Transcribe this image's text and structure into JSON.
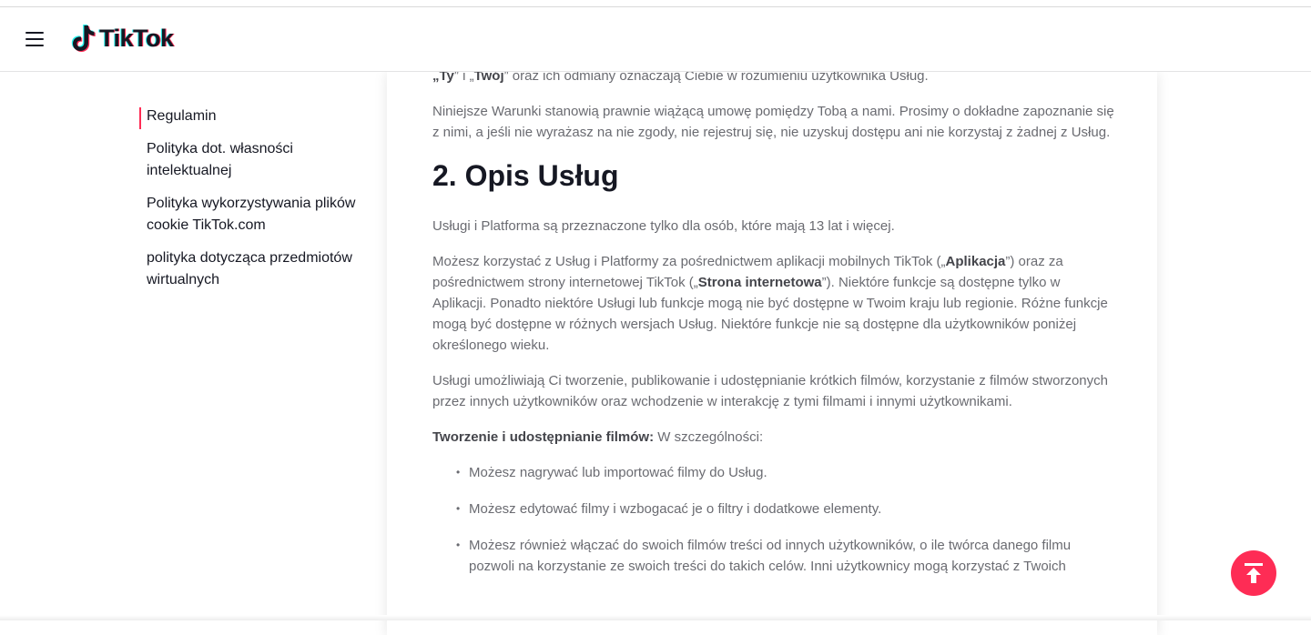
{
  "brand": {
    "name": "TikTok",
    "accent": "#fe2c55",
    "cyan": "#25f4ee"
  },
  "header": {
    "menu_icon": "hamburger-menu-icon",
    "logo_text": "TikTok"
  },
  "sidebar": {
    "items": [
      {
        "label": "Regulamin",
        "active": true
      },
      {
        "label": "Polityka dot. własności intelektualnej"
      },
      {
        "label": "Polityka wykorzystywania plików cookie TikTok.com"
      },
      {
        "label": "polityka dotycząca przedmiotów wirtualnych"
      }
    ]
  },
  "content": {
    "p_ty_1": "„Ty",
    "p_ty_2": "” i „",
    "p_ty_3": "Twój",
    "p_ty_4": "” oraz ich odmiany oznaczają Ciebie w rozumieniu użytkownika Usług.",
    "p_umowa": "Niniejsze Warunki stanowią prawnie wiążącą umowę pomiędzy Tobą a nami. Prosimy o dokładne zapoznanie się z nimi, a jeśli nie wyrażasz na nie zgody, nie rejestruj się, nie uzyskuj dostępu ani nie korzystaj z żadnej z Usług.",
    "heading": "2. Opis Usług",
    "p_wiek": "Usługi i Platforma są przeznaczone tylko dla osób, które mają 13 lat i więcej.",
    "p_app_1": "Możesz korzystać z Usług i Platformy za pośrednictwem aplikacji mobilnych TikTok („",
    "p_app_2": "Aplikacja",
    "p_app_3": "”) oraz za pośrednictwem strony internetowej TikTok („",
    "p_app_4": "Strona internetowa",
    "p_app_5": "”). Niektóre funkcje są dostępne tylko w Aplikacji. Ponadto niektóre Usługi lub funkcje mogą nie być dostępne w Twoim kraju lub regionie. Różne funkcje mogą być dostępne w różnych wersjach Usług. Niektóre funkcje nie są dostępne dla użytkowników poniżej określonego wieku.",
    "p_filmy": "Usługi umożliwiają Ci tworzenie, publikowanie i udostępnianie krótkich filmów, korzystanie z filmów stworzonych przez innych użytkowników oraz wchodzenie w interakcję z tymi filmami i innymi użytkownikami.",
    "p_tworzenie_bold": "Tworzenie i udostępnianie filmów:",
    "p_tworzenie_rest": " W szczególności:",
    "bullets": [
      "Możesz nagrywać lub importować filmy do Usług.",
      "Możesz edytować filmy i wzbogacać je o filtry i dodatkowe elementy.",
      "Możesz również włączać do swoich filmów treści od innych użytkowników, o ile twórca danego filmu pozwoli na korzystanie ze swoich treści do takich celów. Inni użytkownicy mogą korzystać z Twoich"
    ]
  },
  "back_to_top": {
    "icon": "arrow-up-to-top-icon"
  }
}
